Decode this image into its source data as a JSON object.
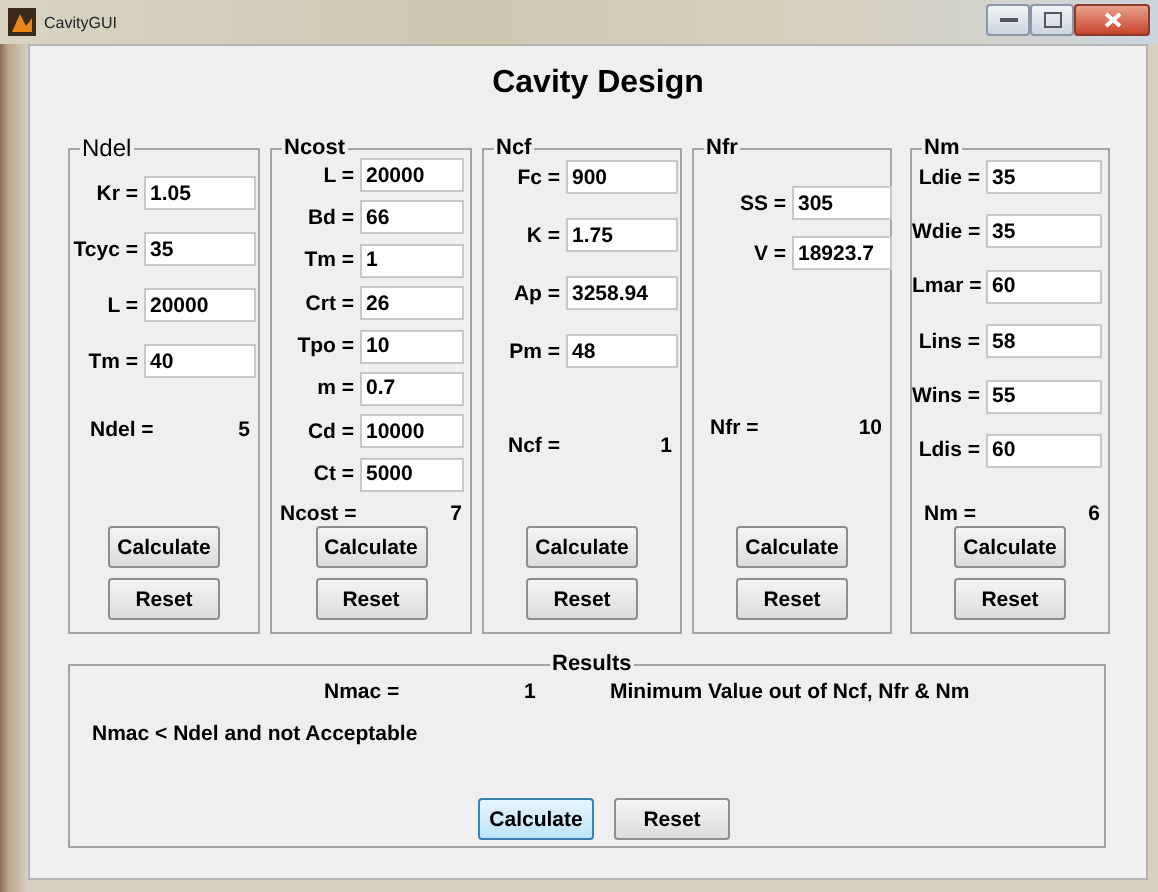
{
  "window": {
    "title": "CavityGUI"
  },
  "heading": "Cavity Design",
  "panels": [
    {
      "title": "Ndel",
      "fields": [
        {
          "label": "Kr =",
          "value": "1.05"
        },
        {
          "label": "Tcyc =",
          "value": "35"
        },
        {
          "label": "L =",
          "value": "20000"
        },
        {
          "label": "Tm =",
          "value": "40"
        }
      ],
      "result": {
        "label": "Ndel =",
        "value": "5"
      },
      "buttons": [
        {
          "label": "Calculate",
          "focused": false
        },
        {
          "label": "Reset",
          "focused": false
        }
      ]
    },
    {
      "title": "Ncost",
      "fields": [
        {
          "label": "L =",
          "value": "20000"
        },
        {
          "label": "Bd =",
          "value": "66"
        },
        {
          "label": "Tm =",
          "value": "1"
        },
        {
          "label": "Crt =",
          "value": "26"
        },
        {
          "label": "Tpo =",
          "value": "10"
        },
        {
          "label": "m =",
          "value": "0.7"
        },
        {
          "label": "Cd =",
          "value": "10000"
        },
        {
          "label": "Ct =",
          "value": "5000"
        }
      ],
      "result": {
        "label": "Ncost =",
        "value": "7"
      },
      "buttons": [
        {
          "label": "Calculate",
          "focused": false
        },
        {
          "label": "Reset",
          "focused": false
        }
      ]
    },
    {
      "title": "Ncf",
      "fields": [
        {
          "label": "Fc =",
          "value": "900"
        },
        {
          "label": "K =",
          "value": "1.75"
        },
        {
          "label": "Ap =",
          "value": "3258.94"
        },
        {
          "label": "Pm =",
          "value": "48"
        }
      ],
      "result": {
        "label": "Ncf =",
        "value": "1"
      },
      "buttons": [
        {
          "label": "Calculate",
          "focused": false
        },
        {
          "label": "Reset",
          "focused": false
        }
      ]
    },
    {
      "title": "Nfr",
      "fields": [
        {
          "label": "SS =",
          "value": "305"
        },
        {
          "label": "V =",
          "value": "18923.7"
        }
      ],
      "result": {
        "label": "Nfr =",
        "value": "10"
      },
      "buttons": [
        {
          "label": "Calculate",
          "focused": false
        },
        {
          "label": "Reset",
          "focused": false
        }
      ]
    },
    {
      "title": "Nm",
      "fields": [
        {
          "label": "Ldie =",
          "value": "35"
        },
        {
          "label": "Wdie =",
          "value": "35"
        },
        {
          "label": "Lmar =",
          "value": "60"
        },
        {
          "label": "Lins =",
          "value": "58"
        },
        {
          "label": "Wins =",
          "value": "55"
        },
        {
          "label": "Ldis =",
          "value": "60"
        }
      ],
      "result": {
        "label": "Nm =",
        "value": "6"
      },
      "buttons": [
        {
          "label": "Calculate",
          "focused": false
        },
        {
          "label": "Reset",
          "focused": false
        }
      ]
    }
  ],
  "results": {
    "title": "Results",
    "label": "Nmac =",
    "value": "1",
    "note": "Minimum Value out of Ncf, Nfr & Nm",
    "message": "Nmac < Ndel and not Acceptable",
    "buttons": [
      {
        "label": "Calculate",
        "focused": true
      },
      {
        "label": "Reset",
        "focused": false
      }
    ]
  }
}
